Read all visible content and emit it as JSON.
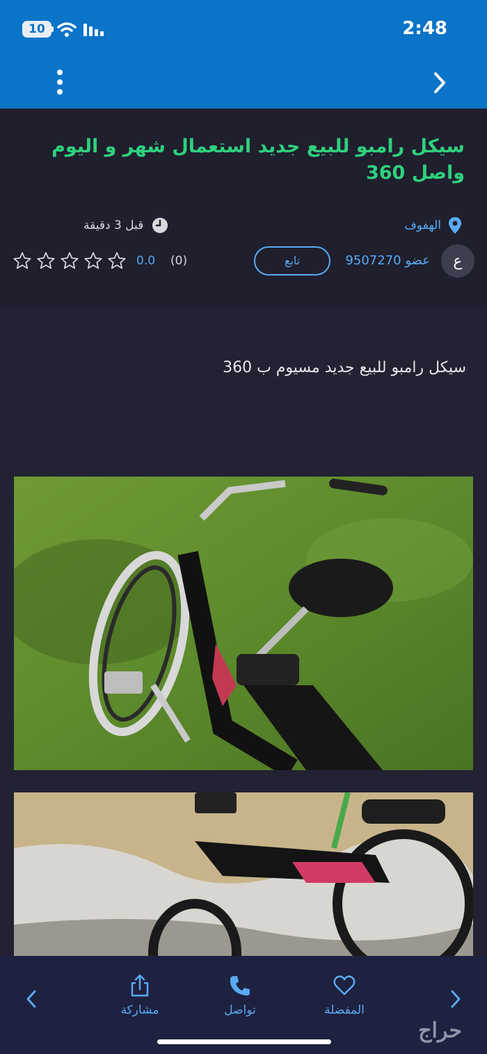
{
  "status_bar": {
    "time": "2:48",
    "battery": "10"
  },
  "listing": {
    "title": "سيكل رامبو للبيع جديد استعمال شهر و اليوم واصل 360",
    "location": "الهفوف",
    "time_ago": "قبل 3 دقيقة",
    "member": "عضو 9507270",
    "avatar_letter": "ع",
    "follow_label": "تابع",
    "rating_value": "0.0",
    "rating_count": "(0)",
    "rating_stars": 0,
    "description": "سيكل رامبو للبيع جديد مسيوم ب 360"
  },
  "bottom_nav": {
    "favorite": "المفضلة",
    "contact": "تواصل",
    "share": "مشاركة"
  },
  "brand": "حراج",
  "colors": {
    "header": "#0a74c8",
    "title": "#2fd07c",
    "accent": "#58aaf2",
    "background": "#1f1f2e"
  },
  "icons": [
    "wifi-icon",
    "signal-icon",
    "menu-dots-icon",
    "back-chevron-icon",
    "location-pin-icon",
    "clock-icon",
    "star-icon",
    "share-icon",
    "phone-icon",
    "heart-icon",
    "chevron-left-icon",
    "chevron-right-icon"
  ]
}
